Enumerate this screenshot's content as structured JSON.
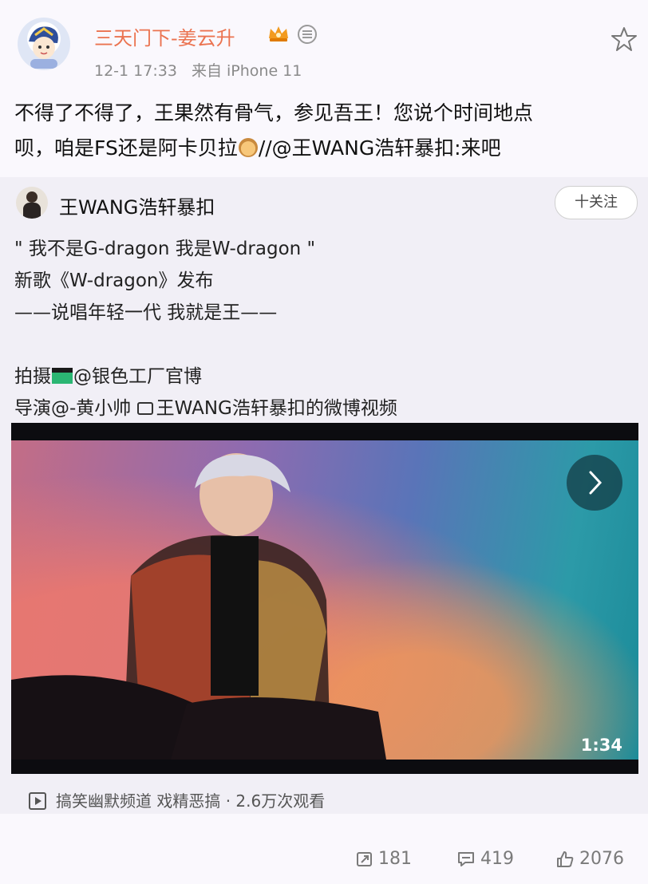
{
  "post": {
    "author": "三天门下-姜云升",
    "time": "12-1 17:33",
    "source": "来自 iPhone 11",
    "text_line1": "不得了不得了，王果然有骨气，参见吾王！您说个时间地点",
    "text_line2_a": "呗，咱是FS还是阿卡贝拉",
    "text_line2_b": "//@王WANG浩轩暴扣:来吧"
  },
  "repost": {
    "author": "王WANG浩轩暴扣",
    "follow_label": "十关注",
    "lines": [
      "\" 我不是G-dragon  我是W-dragon \"",
      "新歌《W-dragon》发布",
      "——说唱年轻一代 我就是王——",
      "",
      "拍摄",
      "@银色工厂官博",
      "导演@-黄小帅 ",
      "王WANG浩轩暴扣的微博视频"
    ],
    "video": {
      "duration": "1:34"
    },
    "source_line": "搞笑幽默频道 戏精恶搞 · 2.6万次观看"
  },
  "actions": {
    "reposts": "181",
    "comments": "419",
    "likes": "2076"
  },
  "colors": {
    "author_name": "#eb7350",
    "meta": "#8a8a8a"
  }
}
